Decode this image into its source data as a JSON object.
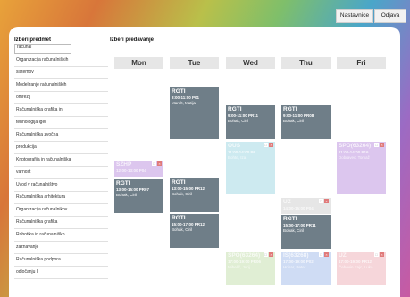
{
  "topbar": {
    "nastavnici": "Nastavnice",
    "odjava": "Odjava"
  },
  "left": {
    "heading": "Izberi predmet",
    "search_value": "računal",
    "subjects": [
      "Organizacija računalniških",
      "sistemov",
      "Modeliranje računalniških",
      "omrežij",
      "Računalniška grafika in",
      "tehnologija iger",
      "Računalniška zvočna",
      "produkcija",
      "Kriptografija in računalniška",
      "varnost",
      "Uvod v računalništvo",
      "Računalniška arhitektura",
      "Organizacija računalnikov",
      "Računalniška grafika",
      "Robotika in računalniško",
      "zaznavanje",
      "Računalniška podpora",
      "odločanju I"
    ]
  },
  "right": {
    "heading": "Izberi predavanje",
    "days": [
      "Mon",
      "Tue",
      "Wed",
      "Thu",
      "Fri"
    ]
  },
  "events": {
    "mon1": {
      "code": "SZHP",
      "time": "12:00-13:00 P04",
      "prof": ""
    },
    "mon2": {
      "code": "RGTI",
      "time": "13:00-15:00 PR07",
      "prof": "Bohak, Ciril"
    },
    "tue1": {
      "code": "RGTI",
      "time": "8:00-11:00 P01",
      "prof": "Marolt, Matija"
    },
    "tue2": {
      "code": "RGTI",
      "time": "13:00-15:00 PR12",
      "prof": "Bohak, Ciril"
    },
    "tue3": {
      "code": "RGTI",
      "time": "15:00-17:00 PR12",
      "prof": "Bohak, Ciril"
    },
    "wed1": {
      "code": "RGTI",
      "time": "9:00-11:00 PR11",
      "prof": "Bohak, Ciril"
    },
    "wed2": {
      "code": "OUS",
      "time": "11:00-14:00 P6",
      "prof": "Bohte, Iza"
    },
    "wed3": {
      "code": "SPO(63264)",
      "time": "17:00-19:00 PR06",
      "prof": "Mihelič, Jurij"
    },
    "thu1": {
      "code": "RGTI",
      "time": "9:00-11:00 PR08",
      "prof": "Bohak, Ciril"
    },
    "thu2": {
      "code": "UZ",
      "time": "14:00-15:00 P04",
      "prof": ""
    },
    "thu3": {
      "code": "RGTI",
      "time": "15:00-17:00 PR11",
      "prof": "Bohak, Ciril"
    },
    "thu4": {
      "code": "IS(63268)",
      "time": "17:00-19:00 P02",
      "prof": "Hribar, Peter"
    },
    "fri1": {
      "code": "SPO(63264)",
      "time": "11:00-14:00 P16",
      "prof": "Dobravec, Tomaž"
    },
    "fri2": {
      "code": "UZ",
      "time": "17:00-19:00 PR12",
      "prof": "Čehovin Zajc, Luka"
    }
  },
  "colors": {
    "dark": "#6f7e88",
    "lavender": "#dcc6ee",
    "cyan": "#cdeaf0",
    "silver": "#e6e6e6",
    "green": "#e0eed4",
    "blue": "#cfdcf4",
    "pink": "#f6d6da"
  }
}
